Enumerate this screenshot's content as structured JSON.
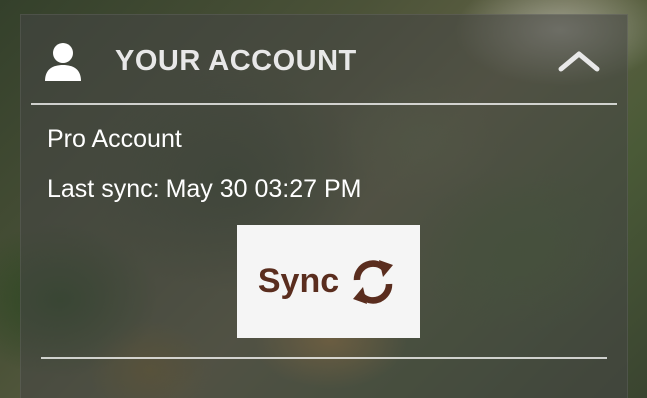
{
  "account_section": {
    "title": "YOUR ACCOUNT",
    "user_icon": "user-icon",
    "collapse_icon": "chevron-up-icon",
    "account_type": "Pro Account",
    "last_sync_label": "Last sync:",
    "last_sync_value": "May 30 03:27 PM",
    "sync_button_label": "Sync",
    "sync_icon": "sync-icon"
  },
  "colors": {
    "sync_brown": "#5a2d1e",
    "panel_overlay": "#464646",
    "text": "#ffffff"
  }
}
